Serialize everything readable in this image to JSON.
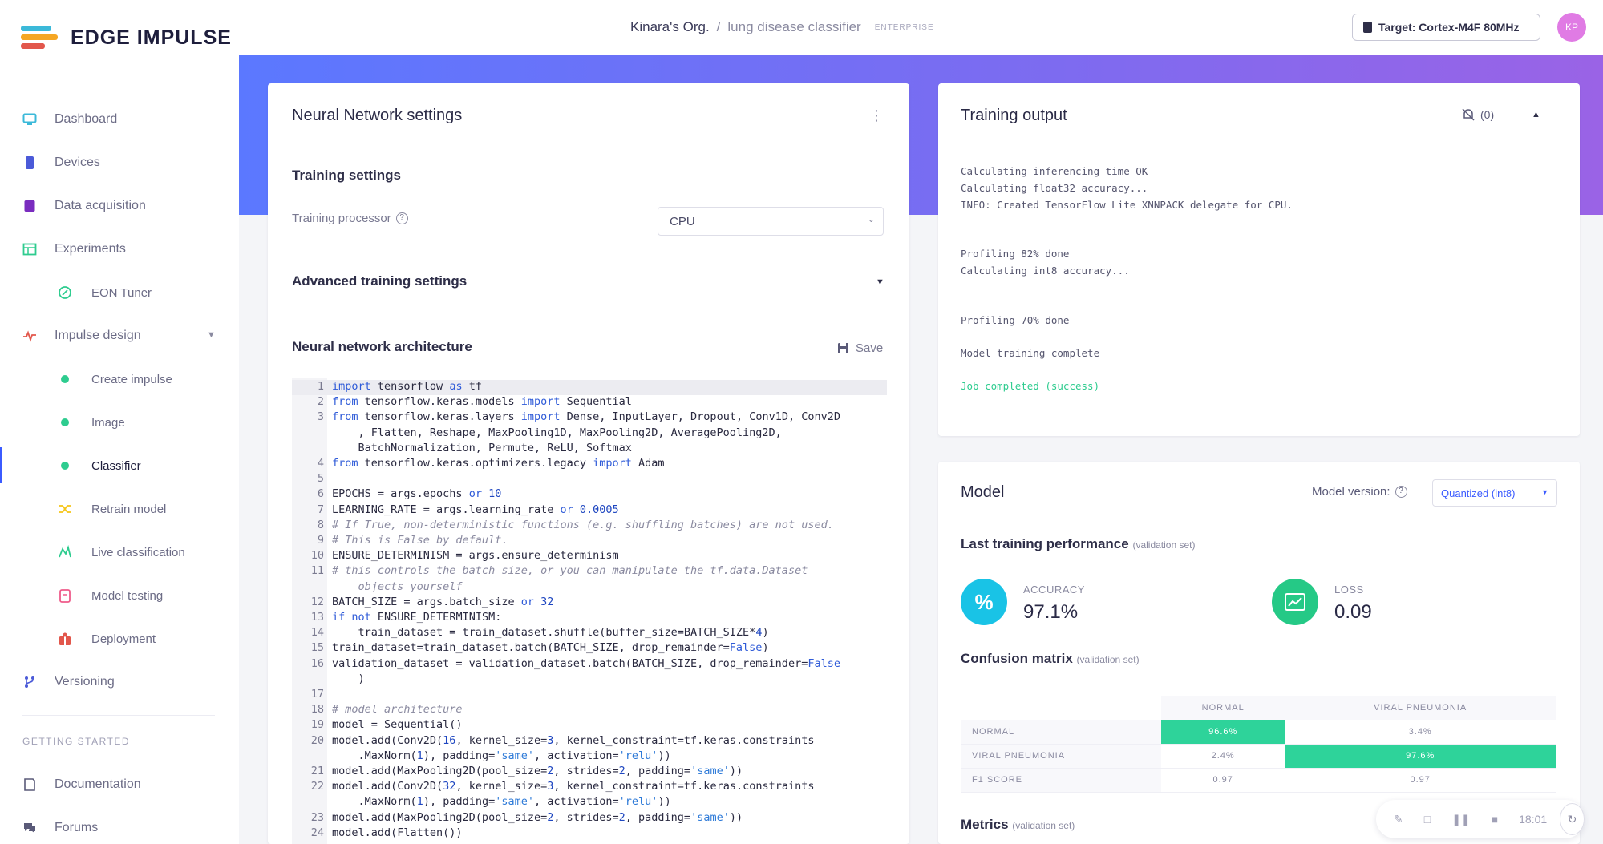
{
  "app": {
    "name": "EDGE IMPULSE"
  },
  "breadcrumb": {
    "org": "Kinara's Org.",
    "sep": "/",
    "project": "lung disease classifier",
    "tier": "ENTERPRISE"
  },
  "target": {
    "label": "Target: Cortex-M4F 80MHz"
  },
  "user": {
    "initials": "KP"
  },
  "sidebar": {
    "items": [
      {
        "label": "Dashboard",
        "icon": "monitor-icon"
      },
      {
        "label": "Devices",
        "icon": "device-icon"
      },
      {
        "label": "Data acquisition",
        "icon": "database-icon"
      },
      {
        "label": "Experiments",
        "icon": "table-icon"
      },
      {
        "label": "EON Tuner",
        "icon": "tuner-icon"
      },
      {
        "label": "Impulse design",
        "icon": "pulse-icon"
      },
      {
        "label": "Create impulse",
        "icon": "dot-icon"
      },
      {
        "label": "Image",
        "icon": "dot-icon"
      },
      {
        "label": "Classifier",
        "icon": "dot-icon"
      },
      {
        "label": "Retrain model",
        "icon": "shuffle-icon"
      },
      {
        "label": "Live classification",
        "icon": "live-icon"
      },
      {
        "label": "Model testing",
        "icon": "clipboard-icon"
      },
      {
        "label": "Deployment",
        "icon": "gift-icon"
      },
      {
        "label": "Versioning",
        "icon": "branch-icon"
      }
    ],
    "section_label": "GETTING STARTED",
    "footer_items": [
      {
        "label": "Documentation",
        "icon": "book-icon"
      },
      {
        "label": "Forums",
        "icon": "chat-icon"
      }
    ]
  },
  "nn_settings": {
    "title": "Neural Network settings",
    "training_settings": "Training settings",
    "processor_label": "Training processor",
    "processor_value": "CPU",
    "advanced": "Advanced training settings",
    "arch_title": "Neural network architecture",
    "save_label": "Save"
  },
  "training_output": {
    "title": "Training output",
    "notif_count": "(0)",
    "lines": [
      "Calculating inferencing time OK",
      "Calculating float32 accuracy...",
      "INFO: Created TensorFlow Lite XNNPACK delegate for CPU.",
      "Profiling 82% done",
      "Calculating int8 accuracy...",
      "Profiling 70% done",
      "Model training complete",
      "Job completed (success)"
    ]
  },
  "model": {
    "title": "Model",
    "version_label": "Model version:",
    "version_value": "Quantized (int8)",
    "perf_title": "Last training performance",
    "perf_sub": "(validation set)",
    "accuracy_label": "ACCURACY",
    "accuracy_value": "97.1%",
    "loss_label": "LOSS",
    "loss_value": "0.09",
    "cm_title": "Confusion matrix",
    "cm_sub": "(validation set)",
    "cm_cols": [
      "NORMAL",
      "VIRAL PNEUMONIA"
    ],
    "cm_rows": [
      {
        "label": "NORMAL",
        "values": [
          "96.6%",
          "3.4%"
        ]
      },
      {
        "label": "VIRAL PNEUMONIA",
        "values": [
          "2.4%",
          "97.6%"
        ]
      },
      {
        "label": "F1 SCORE",
        "values": [
          "0.97",
          "0.97"
        ]
      }
    ],
    "metrics_title": "Metrics",
    "metrics_sub": "(validation set)"
  },
  "floatbar": {
    "time": "18:01"
  },
  "colors": {
    "accent": "#3b5bff",
    "success": "#2ecc8f",
    "teal": "#19c3e6",
    "green": "#25c986"
  }
}
